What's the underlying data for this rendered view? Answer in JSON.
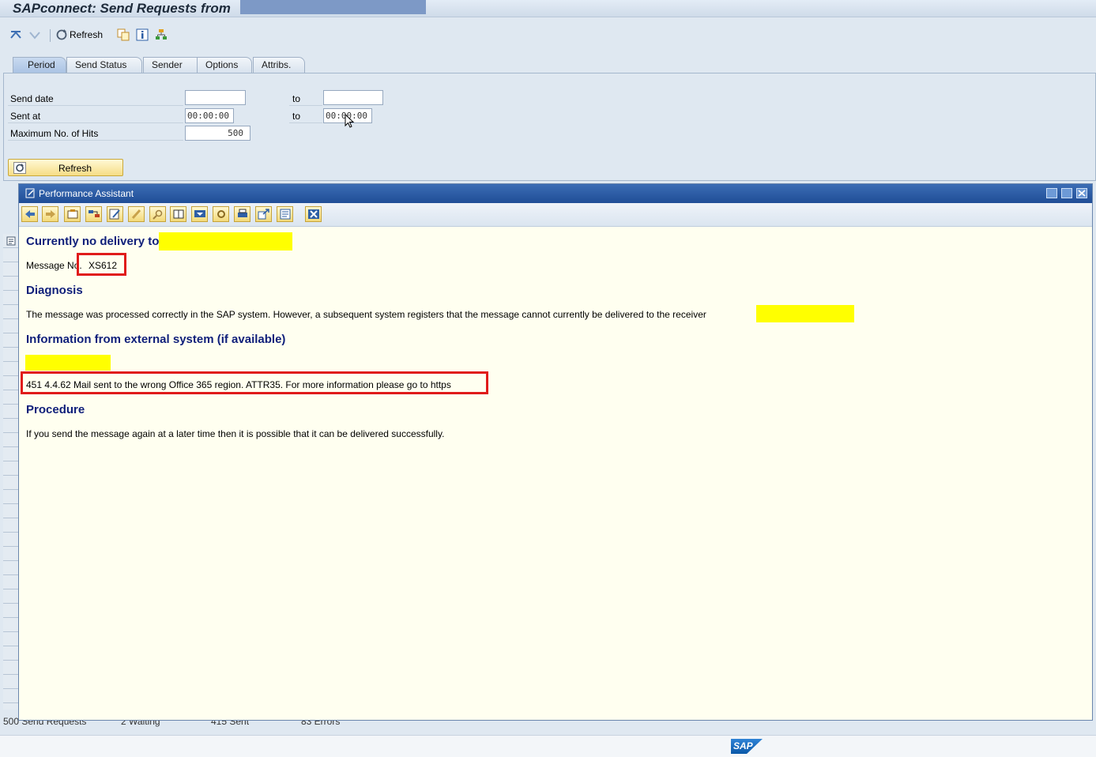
{
  "window": {
    "title": "SAPconnect: Send Requests from"
  },
  "toolbar": {
    "refresh_label": "Refresh"
  },
  "tabs": [
    {
      "label": "Period"
    },
    {
      "label": "Send Status"
    },
    {
      "label": "Sender"
    },
    {
      "label": "Options"
    },
    {
      "label": "Attribs."
    }
  ],
  "form": {
    "send_date_label": "Send date",
    "send_date_from": "",
    "send_date_to_label": "to",
    "send_date_to": "",
    "sent_at_label": "Sent at",
    "sent_at_from": "00:00:00",
    "sent_at_to_label": "to",
    "sent_at_to": "00:00:00",
    "max_hits_label": "Maximum No. of Hits",
    "max_hits": "500",
    "refresh_button": "Refresh"
  },
  "status": {
    "send_requests": "500 Send Requests",
    "waiting": "2 Waiting",
    "sent": "415 Sent",
    "errors": "83 Errors"
  },
  "assistant": {
    "title": "Performance Assistant",
    "heading": "Currently no delivery to",
    "message_no_label": "Message No.",
    "message_no": "XS612",
    "diagnosis_heading": "Diagnosis",
    "diagnosis_text": "The message was processed correctly in the SAP system. However, a subsequent system registers that the message cannot currently be delivered to the receiver",
    "external_heading": "Information from external system (if available)",
    "external_text": "451 4.4.62 Mail sent to the wrong Office 365 region. ATTR35. For more information please go to https",
    "procedure_heading": "Procedure",
    "procedure_text": "If you send the message again at a later time then it is possible that it can be delivered successfully."
  },
  "logo": {
    "text": "SAP"
  },
  "colors": {
    "highlight": "#ffff00",
    "annotation": "#e01b1b",
    "heading": "#0f1f7a",
    "title_bar": "#1f4d96"
  }
}
